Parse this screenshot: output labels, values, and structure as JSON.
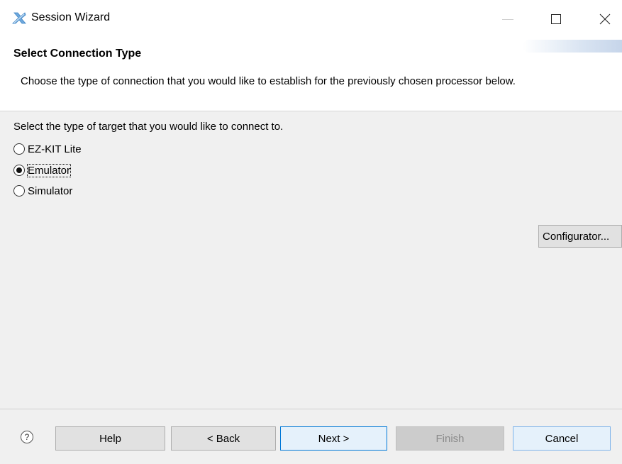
{
  "window": {
    "title": "Session Wizard"
  },
  "header": {
    "title": "Select Connection Type",
    "description": "Choose the type of connection that you would like to establish for the previously chosen processor below."
  },
  "content": {
    "instruction": "Select the type of target that you would like to connect to.",
    "options": [
      {
        "label": "EZ-KIT Lite",
        "selected": false
      },
      {
        "label": "Emulator",
        "selected": true
      },
      {
        "label": "Simulator",
        "selected": false
      }
    ],
    "configurator_label": "Configurator..."
  },
  "footer": {
    "help_icon": "question-circle-icon",
    "help_label": "Help",
    "back_label": "< Back",
    "next_label": "Next >",
    "finish_label": "Finish",
    "cancel_label": "Cancel",
    "finish_enabled": false
  },
  "colors": {
    "accent": "#0078d7",
    "disabled_text": "#8a8a8a"
  }
}
